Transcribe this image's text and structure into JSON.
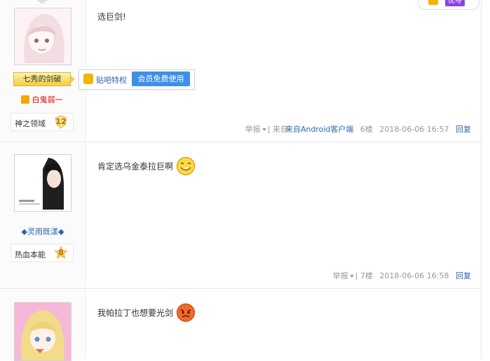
{
  "top_right_button": {
    "label": "优寻"
  },
  "posts": [
    {
      "username": "七秀的剑破",
      "tooltip": {
        "privilege_link": "贴吧特权",
        "member_button": "会员免费使用"
      },
      "title": "白鬼弱一",
      "badge": {
        "name": "神之领域",
        "level": "12"
      },
      "content": "选巨剑!",
      "tail": {
        "report": "举报",
        "source": "来自Android客户端",
        "floor": "6楼",
        "time": "2018-06-06 16:57",
        "reply": "回复"
      }
    },
    {
      "username": "◆灵雨既漾◆",
      "badge": {
        "name": "热血本能",
        "level": "8"
      },
      "content": "肯定选乌金泰拉巨啊",
      "tail": {
        "report": "举报",
        "floor": "7楼",
        "time": "2018-06-06 16:58",
        "reply": "回复"
      }
    },
    {
      "content": "我帕拉丁也想要光剑"
    }
  ]
}
